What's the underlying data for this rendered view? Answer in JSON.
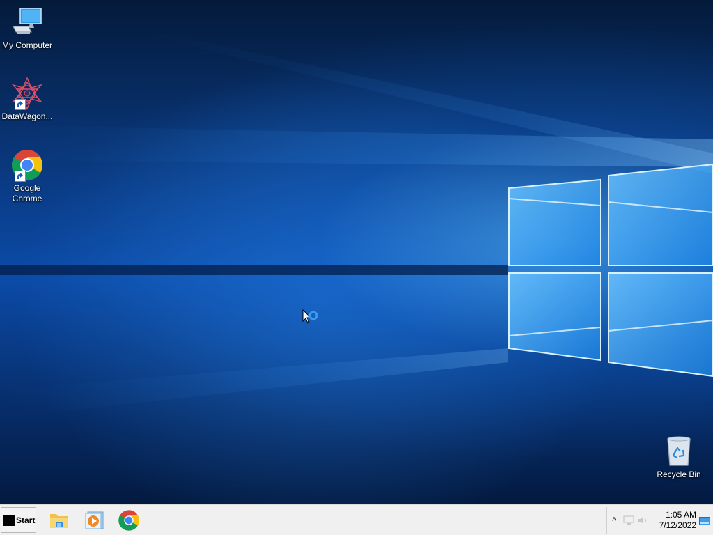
{
  "desktop": {
    "icons": [
      {
        "label": "My Computer",
        "icon": "computer-icon"
      },
      {
        "label": "DataWagon...",
        "icon": "datawagon-icon",
        "shortcut": true
      },
      {
        "label": "Google\nChrome",
        "label_line1": "Google",
        "label_line2": "Chrome",
        "icon": "chrome-icon",
        "shortcut": true
      },
      {
        "label": "Recycle Bin",
        "icon": "recycle-bin-icon"
      }
    ],
    "cursor": "busy-pointer-icon"
  },
  "taskbar": {
    "start_label": "Start",
    "pinned_apps": [
      {
        "name": "File Explorer",
        "icon": "folder-icon"
      },
      {
        "name": "Media Player",
        "icon": "media-player-icon"
      },
      {
        "name": "Google Chrome",
        "icon": "chrome-icon"
      }
    ],
    "tray": {
      "chevron": "˄",
      "time": "1:05 AM",
      "date": "7/12/2022"
    }
  },
  "colors": {
    "wallpaper_blue": "#0b4ba8",
    "taskbar_bg": "#f0f0f0",
    "chrome_red": "#db4437",
    "chrome_yellow": "#f4c20d",
    "chrome_green": "#0f9d58",
    "chrome_blue": "#4285f4"
  }
}
